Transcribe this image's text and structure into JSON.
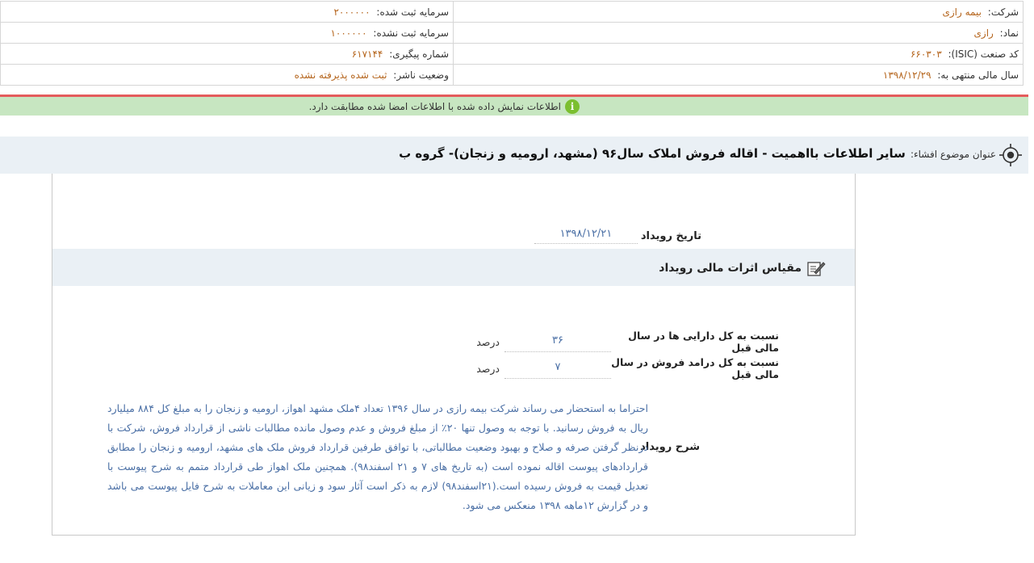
{
  "company_info": {
    "company_label": "شرکت:",
    "company_value": "بیمه رازی",
    "reg_capital_label": "سرمایه ثبت شده:",
    "reg_capital_value": "۲۰۰۰۰۰۰",
    "symbol_label": "نماد:",
    "symbol_value": "رازی",
    "unreg_capital_label": "سرمایه ثبت نشده:",
    "unreg_capital_value": "۱۰۰۰۰۰۰",
    "isic_label": "کد صنعت (ISIC):",
    "isic_value": "۶۶۰۳۰۳",
    "tracking_label": "شماره پیگیری:",
    "tracking_value": "۶۱۷۱۴۴",
    "fiscal_year_label": "سال مالی منتهی به:",
    "fiscal_year_value": "۱۳۹۸/۱۲/۲۹",
    "publisher_status_label": "وضعیت ناشر:",
    "publisher_status_value": "ثبت شده پذیرفته نشده"
  },
  "notice": {
    "text": "اطلاعات نمایش داده شده با اطلاعات امضا شده مطابقت دارد.",
    "icon": "info-icon",
    "icon_glyph": "i"
  },
  "disclosure": {
    "title_label": "عنوان موضوع افشاء:",
    "title_text": "سایر اطلاعات بااهمیت - اقاله فروش املاک سال۹۶ (مشهد، ارومیه و زنجان)- گروه ب"
  },
  "event": {
    "date_label": "تاریخ رویداد",
    "date_value": "۱۳۹۸/۱۲/۲۱",
    "section_title": "مقیاس اثرات مالی رویداد",
    "ratios": [
      {
        "label": "نسبت به کل دارایی ها در سال مالی قبل",
        "value": "۳۶",
        "unit": "درصد"
      },
      {
        "label": "نسبت به کل درامد فروش در سال مالی قبل",
        "value": "۷",
        "unit": "درصد"
      }
    ],
    "description_label": "شرح رویداد",
    "description_text": "احتراما به استحضار می رساند شرکت بیمه رازی در سال ۱۳۹۶ تعداد ۴ملک مشهد اهواز، ارومیه و زنجان را به مبلغ کل ۸۸۴ میلیارد ریال به فروش رسانید. با توجه به وصول تنها ۲۰٪ از مبلغ فروش و عدم وصول مانده مطالبات ناشی از قرارداد فروش، شرکت با درنظر گرفتن صرفه و صلاح و بهبود وضعیت مطالباتی، با توافق طرفین قرارداد فروش ملک های مشهد، ارومیه و زنجان را مطابق قراردادهای پیوست اقاله نموده است (به تاریخ های ۷ و ۲۱ اسفند۹۸). همچنین ملک اهواز طی قرارداد متمم به شرح پیوست با تعدیل قیمت به فروش رسیده است.(۲۱اسفند۹۸) لازم به ذکر است آثار سود و زیانی این معاملات به شرح فایل پیوست می باشد و در گزارش ۱۲ماهه ۱۳۹۸ منعکس می شود."
  },
  "colors": {
    "value_text": "#b5651d",
    "link_blue": "#4a6fa5",
    "notice_bg": "#c7e6c1",
    "notice_border": "#e45c5c",
    "header_bg": "#eaf0f5"
  }
}
